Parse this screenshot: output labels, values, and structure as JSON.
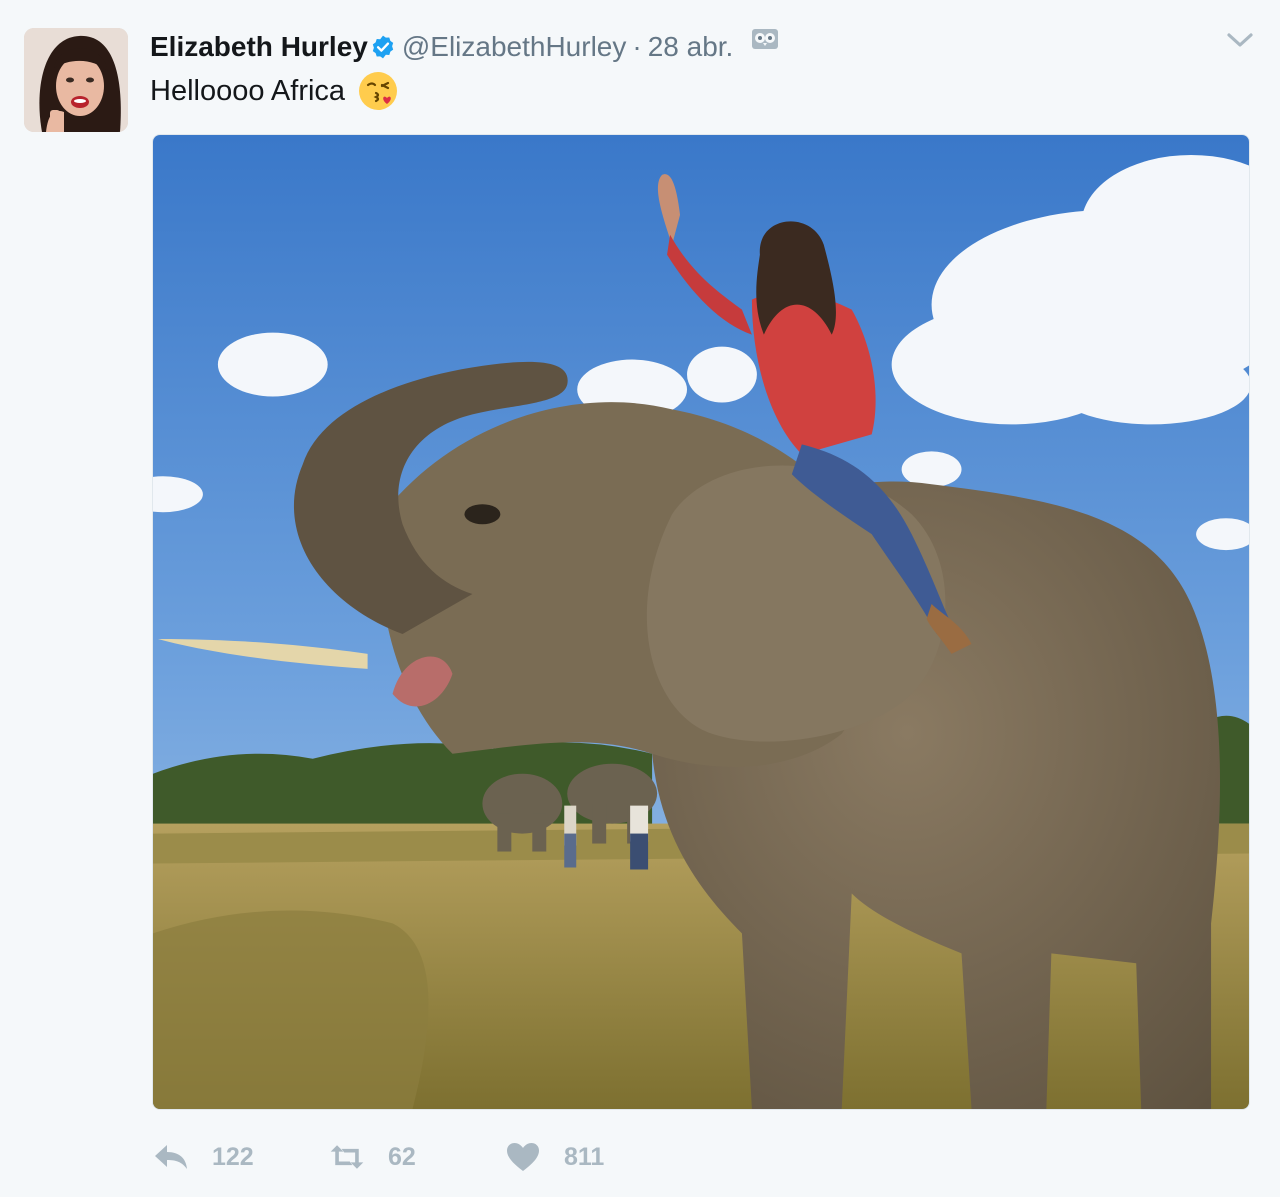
{
  "tweet": {
    "author_name": "Elizabeth Hurley",
    "handle": "@ElizabethHurley",
    "separator": "·",
    "date": "28 abr.",
    "text": "Helloooo Africa",
    "emoji": "kissing-face-with-heart-emoji",
    "icons": {
      "verified": "verified-badge-icon",
      "owl": "owl-icon",
      "caret": "chevron-down-icon"
    },
    "actions": {
      "reply_count": "122",
      "retweet_count": "62",
      "like_count": "811"
    },
    "colors": {
      "verified_blue": "#1da1f2",
      "muted_text": "#657786",
      "action_gray": "#aab8c2"
    }
  }
}
